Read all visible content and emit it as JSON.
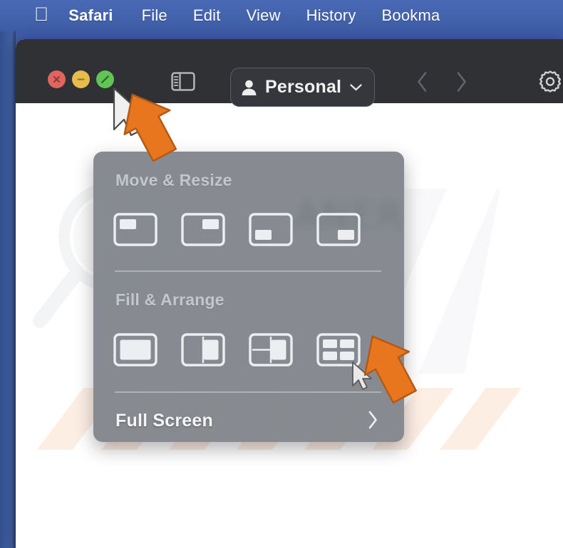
{
  "menubar": {
    "apple_icon": "apple-logo-icon",
    "items": [
      {
        "label": "Safari",
        "bold": true
      },
      {
        "label": "File",
        "bold": false
      },
      {
        "label": "Edit",
        "bold": false
      },
      {
        "label": "View",
        "bold": false
      },
      {
        "label": "History",
        "bold": false
      },
      {
        "label": "Bookma",
        "bold": false
      }
    ]
  },
  "toolbar": {
    "traffic_lights": [
      {
        "name": "close",
        "icon": "close-x-icon",
        "color": "#e0645f"
      },
      {
        "name": "minimize",
        "icon": "minus-icon",
        "color": "#e8bb4d"
      },
      {
        "name": "zoom",
        "icon": "maximize-arrows-icon",
        "color": "#61c454"
      }
    ],
    "sidebar_toggle_icon": "sidebar-toggle-icon",
    "profile": {
      "label": "Personal",
      "person_icon": "person-icon",
      "chevron_icon": "chevron-down-icon"
    },
    "nav_back_icon": "chevron-left-icon",
    "nav_forward_icon": "chevron-right-icon",
    "settings_icon": "gear-icon",
    "background_color": "#2f3135"
  },
  "page": {
    "brand_text": "ANER",
    "brand_color": "#4e5f77",
    "background_color": "#ffffff"
  },
  "window_menu": {
    "sections": [
      {
        "title": "Move & Resize",
        "options": [
          {
            "name": "top-left",
            "icon": "window-top-left-icon"
          },
          {
            "name": "top-right",
            "icon": "window-top-right-icon"
          },
          {
            "name": "bottom-left",
            "icon": "window-bottom-left-icon"
          },
          {
            "name": "bottom-right",
            "icon": "window-bottom-right-icon"
          }
        ]
      },
      {
        "title": "Fill & Arrange",
        "options": [
          {
            "name": "fill",
            "icon": "window-fill-icon"
          },
          {
            "name": "left-and-right",
            "icon": "window-split-halves-icon"
          },
          {
            "name": "quarters-and-side",
            "icon": "window-quarters-side-icon"
          },
          {
            "name": "four-quadrants",
            "icon": "window-four-quadrants-icon"
          }
        ]
      }
    ],
    "full_screen": {
      "label": "Full Screen",
      "submenu_icon": "chevron-right-icon"
    },
    "panel_color": "#7a7e85"
  },
  "annotations": {
    "arrow_color": "#e8761f",
    "arrows": [
      {
        "name": "arrow-pointing-green-button",
        "target": "zoom-traffic-light"
      },
      {
        "name": "arrow-pointing-full-screen",
        "target": "full-screen-submenu"
      }
    ]
  },
  "desktop": {
    "wallpaper_color": "#3f5ca8"
  }
}
